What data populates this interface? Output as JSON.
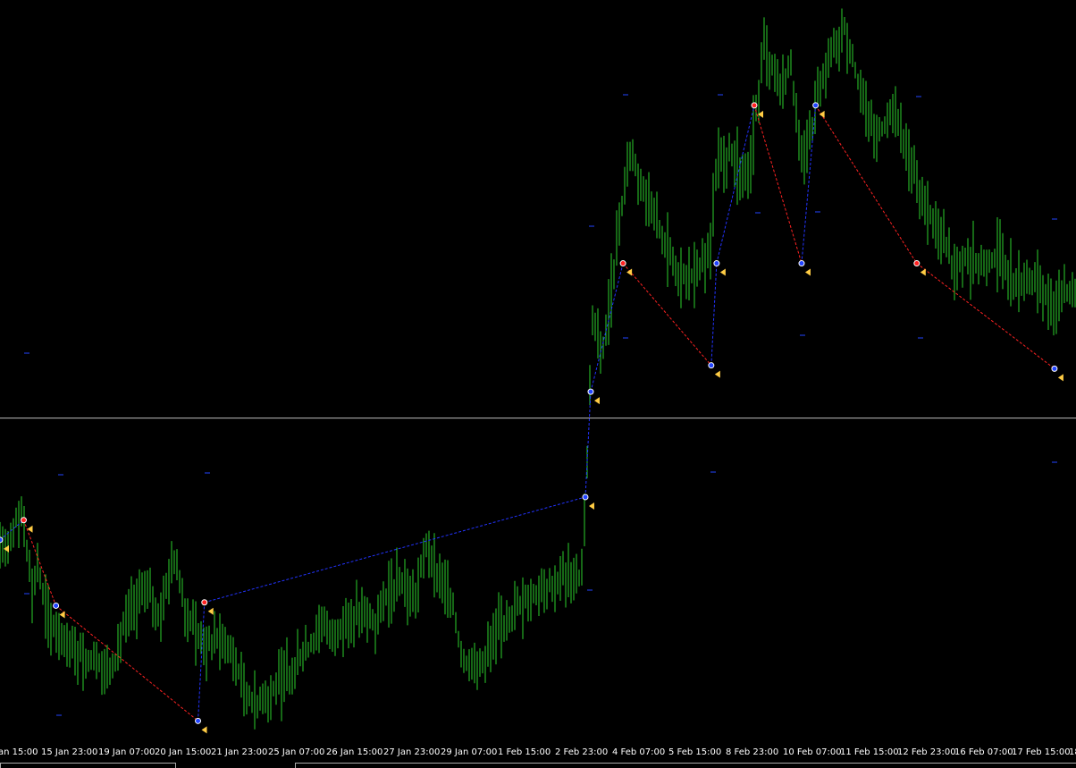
{
  "chart_data": {
    "type": "line",
    "x_tick_labels": [
      "an 15:00",
      "15 Jan 23:00",
      "19 Jan 07:00",
      "20 Jan 15:00",
      "21 Jan 23:00",
      "25 Jan 07:00",
      "26 Jan 15:00",
      "27 Jan 23:00",
      "29 Jan 07:00",
      "1 Feb 15:00",
      "2 Feb 23:00",
      "4 Feb 07:00",
      "5 Feb 15:00",
      "8 Feb 23:00",
      "10 Feb 07:00",
      "11 Feb 15:00",
      "12 Feb 23:00",
      "16 Feb 07:00",
      "17 Feb 15:00",
      "18"
    ],
    "price_profile": [
      [
        0,
        0.5
      ],
      [
        0.02,
        0.66
      ],
      [
        0.03,
        0.4
      ],
      [
        0.035,
        0.48
      ],
      [
        0.045,
        0.32
      ],
      [
        0.06,
        0.24
      ],
      [
        0.08,
        0.2
      ],
      [
        0.105,
        0.16
      ],
      [
        0.115,
        0.3
      ],
      [
        0.135,
        0.42
      ],
      [
        0.15,
        0.32
      ],
      [
        0.16,
        0.52
      ],
      [
        0.175,
        0.32
      ],
      [
        0.19,
        0.24
      ],
      [
        0.205,
        0.26
      ],
      [
        0.185,
        0.4
      ],
      [
        0.19,
        0.02
      ],
      [
        0.2,
        0.32
      ],
      [
        0.21,
        0.24
      ],
      [
        0.225,
        0.14
      ],
      [
        0.235,
        0.06
      ],
      [
        0.245,
        0.08
      ],
      [
        0.265,
        0.14
      ],
      [
        0.285,
        0.22
      ],
      [
        0.3,
        0.3
      ],
      [
        0.315,
        0.28
      ],
      [
        0.33,
        0.34
      ],
      [
        0.35,
        0.3
      ],
      [
        0.36,
        0.4
      ],
      [
        0.375,
        0.42
      ],
      [
        0.385,
        0.36
      ],
      [
        0.395,
        0.55
      ],
      [
        0.405,
        0.46
      ],
      [
        0.42,
        0.38
      ],
      [
        0.43,
        0.18
      ],
      [
        0.45,
        0.2
      ],
      [
        0.47,
        0.32
      ],
      [
        0.49,
        0.38
      ],
      [
        0.51,
        0.42
      ],
      [
        0.53,
        0.46
      ],
      [
        0.54,
        0.44
      ],
      [
        0.545,
        0.72
      ],
      [
        0.55,
        1.22
      ],
      [
        0.56,
        1.12
      ],
      [
        0.575,
        1.5
      ],
      [
        0.585,
        1.74
      ],
      [
        0.6,
        1.62
      ],
      [
        0.615,
        1.48
      ],
      [
        0.63,
        1.38
      ],
      [
        0.645,
        1.36
      ],
      [
        0.66,
        1.44
      ],
      [
        0.665,
        1.68
      ],
      [
        0.68,
        1.74
      ],
      [
        0.695,
        1.64
      ],
      [
        0.71,
        2.06
      ],
      [
        0.725,
        1.94
      ],
      [
        0.735,
        2.0
      ],
      [
        0.745,
        1.7
      ],
      [
        0.755,
        1.8
      ],
      [
        0.76,
        1.94
      ],
      [
        0.77,
        2.02
      ],
      [
        0.785,
        2.12
      ],
      [
        0.8,
        1.92
      ],
      [
        0.815,
        1.78
      ],
      [
        0.83,
        1.86
      ],
      [
        0.845,
        1.72
      ],
      [
        0.86,
        1.58
      ],
      [
        0.87,
        1.52
      ],
      [
        0.885,
        1.4
      ],
      [
        0.9,
        1.42
      ],
      [
        0.915,
        1.38
      ],
      [
        0.93,
        1.44
      ],
      [
        0.945,
        1.32
      ],
      [
        0.96,
        1.36
      ],
      [
        0.975,
        1.28
      ],
      [
        0.99,
        1.32
      ],
      [
        1.0,
        1.3
      ]
    ],
    "zigzag_points": [
      [
        0.0,
        0.56
      ],
      [
        0.022,
        0.62
      ],
      [
        0.052,
        0.36
      ],
      [
        0.184,
        0.01
      ],
      [
        0.19,
        0.37
      ],
      [
        0.544,
        0.69
      ],
      [
        0.549,
        1.01
      ],
      [
        0.579,
        1.4
      ],
      [
        0.661,
        1.09
      ],
      [
        0.666,
        1.4
      ],
      [
        0.701,
        1.88
      ],
      [
        0.745,
        1.4
      ],
      [
        0.758,
        1.88
      ],
      [
        0.852,
        1.4
      ],
      [
        0.98,
        1.08
      ]
    ],
    "horizontal_level": 0.93,
    "colors": {
      "price": "#2bd12b",
      "background": "#000000",
      "zigzag_up": "#2233ff",
      "zigzag_down": "#ff2222",
      "level_line": "#bbbbbb",
      "arrow_blue": "#2244ff",
      "arrow_red": "#ff2222",
      "arrow_yellow": "#ffcc44"
    }
  }
}
